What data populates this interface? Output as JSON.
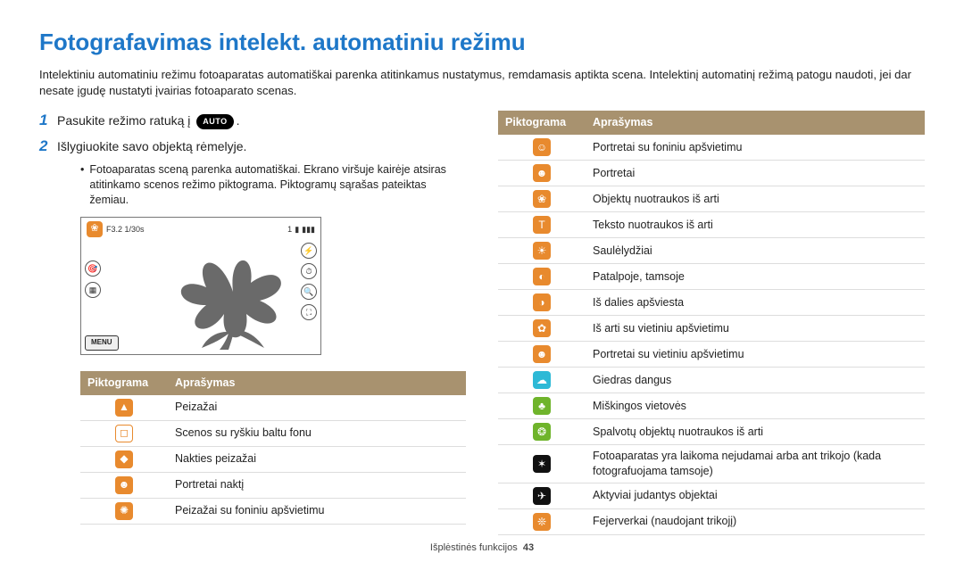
{
  "header": {
    "title": "Fotografavimas intelekt. automatiniu režimu",
    "intro": "Intelektiniu automatiniu režimu fotoaparatas automatiškai parenka atitinkamus nustatymus, remdamasis aptikta scena. Intelektinį automatinį režimą patogu naudoti, jei dar nesate įgudę nustatyti įvairias fotoaparato scenas."
  },
  "steps": [
    {
      "num": "1",
      "text_before": "Pasukite režimo ratuką į",
      "badge": "AUTO",
      "text_after": "."
    },
    {
      "num": "2",
      "text_before": "Išlygiuokite savo objektą rėmelyje.",
      "badge": "",
      "text_after": ""
    }
  ],
  "substep": "Fotoaparatas sceną parenka automatiškai. Ekrano viršuje kairėje atsiras atitinkamo scenos režimo piktograma. Piktogramų sąrašas pateiktas žemiau.",
  "camera": {
    "exposure": "F3.2  1/30s",
    "top_right_count": "1",
    "menu_label": "MENU",
    "side_icons": [
      "⚡",
      "⏱",
      "🔍",
      "⛶"
    ],
    "left_icons": [
      "🎯",
      "▦"
    ]
  },
  "table_headers": {
    "icon": "Piktograma",
    "desc": "Aprašymas"
  },
  "left_table": [
    {
      "glyph": "▲",
      "cls": "orange",
      "desc": "Peizažai"
    },
    {
      "glyph": "◻",
      "cls": "outline-white",
      "desc": "Scenos su ryškiu baltu fonu"
    },
    {
      "glyph": "◆",
      "cls": "orange",
      "desc": "Nakties peizažai"
    },
    {
      "glyph": "☻",
      "cls": "orange",
      "desc": "Portretai naktį"
    },
    {
      "glyph": "✺",
      "cls": "orange",
      "desc": "Peizažai su foniniu apšvietimu"
    }
  ],
  "right_table": [
    {
      "glyph": "☺",
      "cls": "orange",
      "desc": "Portretai su foniniu apšvietimu"
    },
    {
      "glyph": "☻",
      "cls": "orange",
      "desc": "Portretai"
    },
    {
      "glyph": "❀",
      "cls": "orange",
      "desc": "Objektų nuotraukos iš arti"
    },
    {
      "glyph": "T",
      "cls": "orange",
      "desc": "Teksto nuotraukos iš arti"
    },
    {
      "glyph": "☀",
      "cls": "orange",
      "desc": "Saulėlydžiai"
    },
    {
      "glyph": "◐",
      "cls": "orange",
      "desc": "Patalpoje, tamsoje"
    },
    {
      "glyph": "◑",
      "cls": "orange",
      "desc": "Iš dalies apšviesta"
    },
    {
      "glyph": "✿",
      "cls": "orange",
      "desc": "Iš arti su vietiniu apšvietimu"
    },
    {
      "glyph": "☻",
      "cls": "orange",
      "desc": "Portretai su vietiniu apšvietimu"
    },
    {
      "glyph": "☁",
      "cls": "cyan",
      "desc": "Giedras dangus"
    },
    {
      "glyph": "♣",
      "cls": "green",
      "desc": "Miškingos vietovės"
    },
    {
      "glyph": "❂",
      "cls": "green",
      "desc": "Spalvotų objektų nuotraukos iš arti"
    },
    {
      "glyph": "✶",
      "cls": "black",
      "desc": "Fotoaparatas yra laikoma nejudamai arba ant trikojo (kada fotografuojama tamsoje)"
    },
    {
      "glyph": "✈",
      "cls": "black",
      "desc": "Aktyviai judantys objektai"
    },
    {
      "glyph": "❊",
      "cls": "orange",
      "desc": "Fejerverkai (naudojant trikojį)"
    }
  ],
  "footer": {
    "section": "Išplėstinės funkcijos",
    "page": "43"
  }
}
